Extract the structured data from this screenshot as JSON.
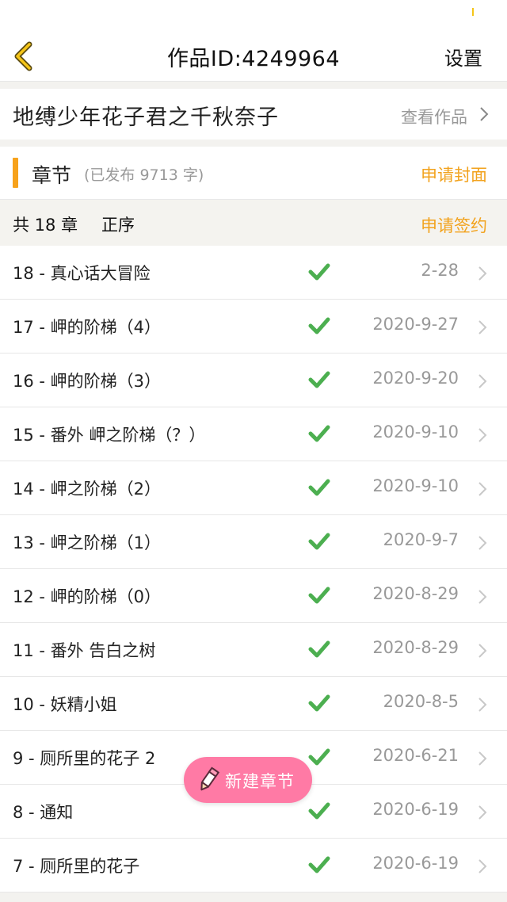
{
  "header": {
    "title": "作品ID:4249964",
    "settings_label": "设置"
  },
  "work": {
    "title": "地缚少年花子君之千秋奈子",
    "view_label": "查看作品"
  },
  "section": {
    "title": "章节",
    "subtitle": "(已发布 9713 字)",
    "apply_cover_label": "申请封面"
  },
  "summary": {
    "count_label": "共 18 章",
    "sort_label": "正序",
    "apply_sign_label": "申请签约"
  },
  "chapters": [
    {
      "title": "18 - 真心话大冒险",
      "date": "2-28",
      "status": "published"
    },
    {
      "title": "17 - 岬的阶梯（4）",
      "date": "2020-9-27",
      "status": "published"
    },
    {
      "title": "16 - 岬的阶梯（3）",
      "date": "2020-9-20",
      "status": "published"
    },
    {
      "title": "15 - 番外 岬之阶梯（？）",
      "date": "2020-9-10",
      "status": "published"
    },
    {
      "title": "14 - 岬之阶梯（2）",
      "date": "2020-9-10",
      "status": "published"
    },
    {
      "title": "13 - 岬之阶梯（1）",
      "date": "2020-9-7",
      "status": "published"
    },
    {
      "title": "12 - 岬的阶梯（0）",
      "date": "2020-8-29",
      "status": "published"
    },
    {
      "title": "11 - 番外 告白之树",
      "date": "2020-8-29",
      "status": "published"
    },
    {
      "title": "10 - 妖精小姐",
      "date": "2020-8-5",
      "status": "published"
    },
    {
      "title": "9 - 厕所里的花子 2",
      "date": "2020-6-21",
      "status": "published"
    },
    {
      "title": "8 - 通知",
      "date": "2020-6-19",
      "status": "published"
    },
    {
      "title": "7 - 厕所里的花子",
      "date": "2020-6-19",
      "status": "published"
    }
  ],
  "fab": {
    "label": "新建章节",
    "icon": "pencil-icon"
  },
  "colors": {
    "accent": "#f2a21c",
    "check": "#4caf50",
    "fab": "#ff7aa5"
  }
}
